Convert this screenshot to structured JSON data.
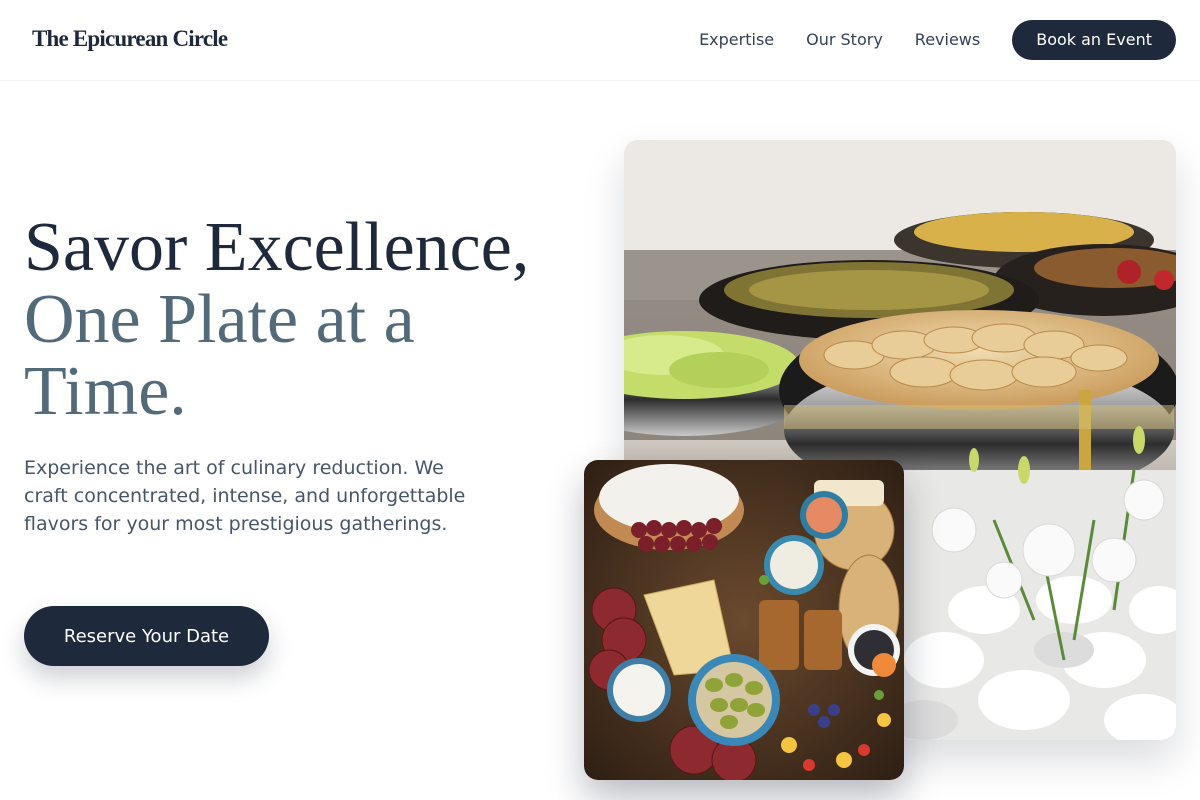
{
  "header": {
    "logo": "The Epicurean Circle",
    "nav": [
      "Expertise",
      "Our Story",
      "Reviews"
    ],
    "cta": "Book an Event"
  },
  "hero": {
    "title_line1": "Savor Excellence,",
    "title_line2": "One Plate at a",
    "title_line3": "Time.",
    "subtitle": "Experience the art of culinary reduction. We craft concentrated, intense, and unforgettable flavors for your most prestigious gatherings.",
    "cta": "Reserve Your Date"
  },
  "images": {
    "main": "catering-buffet-chafing-dishes-photo",
    "secondary": "charcuterie-cheese-board-photo"
  },
  "colors": {
    "primary": "#1e293b",
    "accent": "#536a7a",
    "body_text": "#475569",
    "background": "#ffffff"
  }
}
